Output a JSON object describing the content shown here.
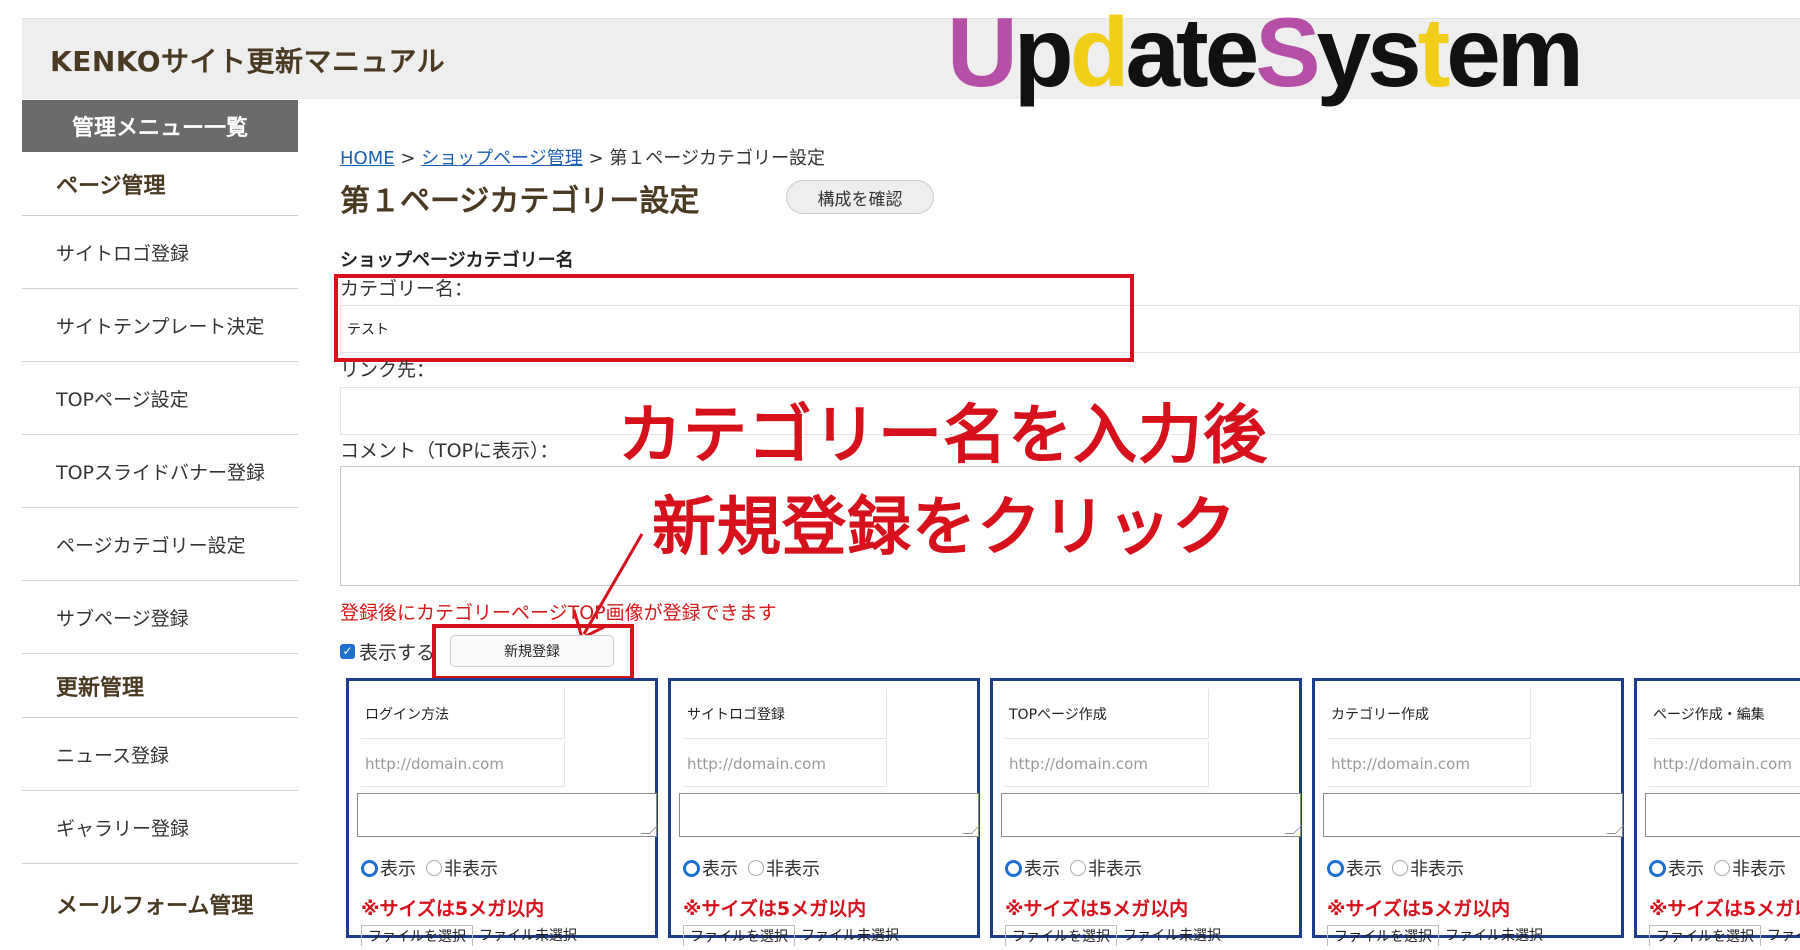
{
  "header": {
    "site_title": "KENKOサイト更新マニュアル",
    "logo_letters": [
      {
        "ch": "U",
        "color": "#b64fa6"
      },
      {
        "ch": "p",
        "color": "#111111"
      },
      {
        "ch": "d",
        "color": "#f1cf18"
      },
      {
        "ch": "a",
        "color": "#111111"
      },
      {
        "ch": "t",
        "color": "#111111"
      },
      {
        "ch": "e",
        "color": "#111111"
      },
      {
        "ch": "S",
        "color": "#b64fa6"
      },
      {
        "ch": "y",
        "color": "#111111"
      },
      {
        "ch": "s",
        "color": "#111111"
      },
      {
        "ch": "t",
        "color": "#f1cf18"
      },
      {
        "ch": "e",
        "color": "#111111"
      },
      {
        "ch": "m",
        "color": "#111111"
      }
    ]
  },
  "sidebar": {
    "menu_header": "管理メニュー一覧",
    "section_page": "ページ管理",
    "items_page": [
      "サイトロゴ登録",
      "サイトテンプレート決定",
      "TOPページ設定",
      "TOPスライドバナー登録",
      "ページカテゴリー設定",
      "サブページ登録"
    ],
    "section_update": "更新管理",
    "items_update": [
      "ニュース登録",
      "ギャラリー登録"
    ],
    "section_mail": "メールフォーム管理"
  },
  "breadcrumb": {
    "home": "HOME",
    "sep1": " > ",
    "shop": "ショップページ管理",
    "sep2": " > ",
    "current": "第１ページカテゴリー設定"
  },
  "main": {
    "page_title": "第１ページカテゴリー設定",
    "confirm_button": "構成を確認",
    "section_label": "ショップページカテゴリー名",
    "category_label": "カテゴリー名：",
    "category_value": "テスト",
    "link_label": "リンク先：",
    "link_value": "",
    "comment_label": "コメント（TOPに表示）：",
    "notice": "登録後にカテゴリーページTOP画像が登録できます",
    "show_label": "表示する",
    "new_button": "新規登録"
  },
  "annotation": {
    "line1": "カテゴリー名を入力後",
    "line2": "新規登録をクリック"
  },
  "cards": [
    {
      "title": "ログイン方法",
      "url_placeholder": "http://domain.com"
    },
    {
      "title": "サイトロゴ登録",
      "url_placeholder": "http://domain.com"
    },
    {
      "title": "TOPページ作成",
      "url_placeholder": "http://domain.com"
    },
    {
      "title": "カテゴリー作成",
      "url_placeholder": "http://domain.com"
    },
    {
      "title": "ページ作成・編集",
      "url_placeholder": "http://domain.com"
    }
  ],
  "card_common": {
    "show": "表示",
    "hide": "非表示",
    "warn": "※サイズは5メガ以内",
    "file_button": "ファイルを選択",
    "file_status": "ファイル未選択"
  },
  "colors": {
    "annotation_red": "#d6111c",
    "card_border": "#1c3c8f",
    "header_bg": "#eeeeee",
    "sidebar_head_bg": "#6b6b6b"
  }
}
